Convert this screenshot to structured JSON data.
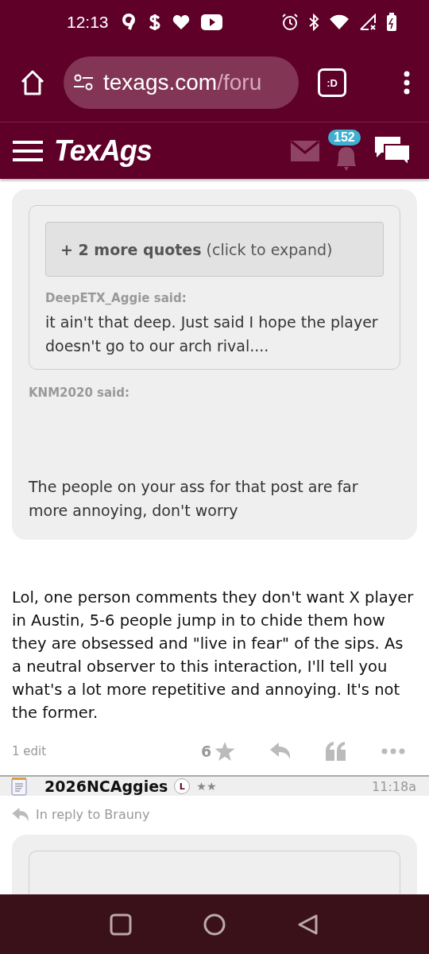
{
  "status_bar": {
    "time": "12:13"
  },
  "browser": {
    "url_host": "texags.com",
    "url_path": "/foru",
    "tab_label": ":D"
  },
  "site_header": {
    "logo": "TexAgs",
    "notification_count": "152"
  },
  "quote_card": {
    "expand_button": {
      "bold": "+ 2 more quotes",
      "rest": "(click to expand)"
    },
    "nested_quote": {
      "author": "DeepETX_Aggie said:",
      "text": "it ain't that deep. Just said I hope the player doesn't go to our arch rival...."
    },
    "author": "KNM2020 said:",
    "text": "The people on your ass for that post are far more annoying, don't worry"
  },
  "post_body": "Lol, one person comments they don't want X player in Austin, 5-6 people jump in to chide them how they are obsessed and \"live in fear\" of the sips. As a neutral observer to this interaction, I'll tell you what's a lot more repetitive and annoying. It's not the former.",
  "post_footer": {
    "edits": "1 edit",
    "star_count": "6"
  },
  "next_post": {
    "username": "2026NCAggies",
    "badge": "L",
    "rank_stars": "★★",
    "time": "11:18a",
    "in_reply_to": "In reply to Brauny"
  }
}
